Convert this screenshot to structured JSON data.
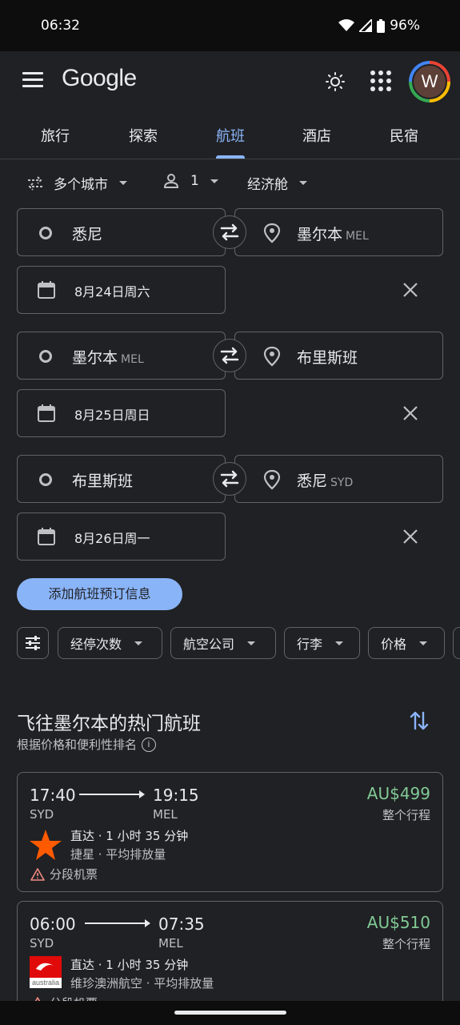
{
  "status": {
    "time": "06:32",
    "battery": "96%"
  },
  "header": {
    "logo": "Google",
    "avatar_initial": "W"
  },
  "tabs": [
    {
      "label": "旅行"
    },
    {
      "label": "探索"
    },
    {
      "label": "航班"
    },
    {
      "label": "酒店"
    },
    {
      "label": "民宿"
    }
  ],
  "search_options": {
    "trip_type": "多个城市",
    "passengers": "1",
    "cabin": "经济舱"
  },
  "legs": [
    {
      "origin": "悉尼",
      "origin_code": "",
      "destination": "墨尔本",
      "destination_code": "MEL",
      "date": "8月24日周六"
    },
    {
      "origin": "墨尔本",
      "origin_code": "MEL",
      "destination": "布里斯班",
      "destination_code": "",
      "date": "8月25日周日"
    },
    {
      "origin": "布里斯班",
      "origin_code": "",
      "destination": "悉尼",
      "destination_code": "SYD",
      "date": "8月26日周一"
    }
  ],
  "add_flight_label": "添加航班预订信息",
  "filters": [
    {
      "label": "经停次数"
    },
    {
      "label": "航空公司"
    },
    {
      "label": "行李"
    },
    {
      "label": "价格"
    }
  ],
  "results": {
    "title": "飞往墨尔本的热门航班",
    "subtitle": "根据价格和便利性排名",
    "flights": [
      {
        "dep_time": "17:40",
        "dep_code": "SYD",
        "arr_time": "19:15",
        "arr_code": "MEL",
        "price": "AU$499",
        "trip_label": "整个行程",
        "details": "直达 · 1 小时 35 分钟",
        "airline": "捷星 · 平均排放量",
        "warning": "分段机票"
      },
      {
        "dep_time": "06:00",
        "dep_code": "SYD",
        "arr_time": "07:35",
        "arr_code": "MEL",
        "price": "AU$510",
        "trip_label": "整个行程",
        "details": "直达 · 1 小时 35 分钟",
        "airline": "维珍澳洲航空 · 平均排放量",
        "warning": "分段机票",
        "logo_text": "australia"
      }
    ]
  },
  "colors": {
    "accent": "#8ab4f8",
    "price": "#81c995",
    "background": "#202124",
    "jetstar": "#ff5a00",
    "virgin": "#e10a0a"
  }
}
